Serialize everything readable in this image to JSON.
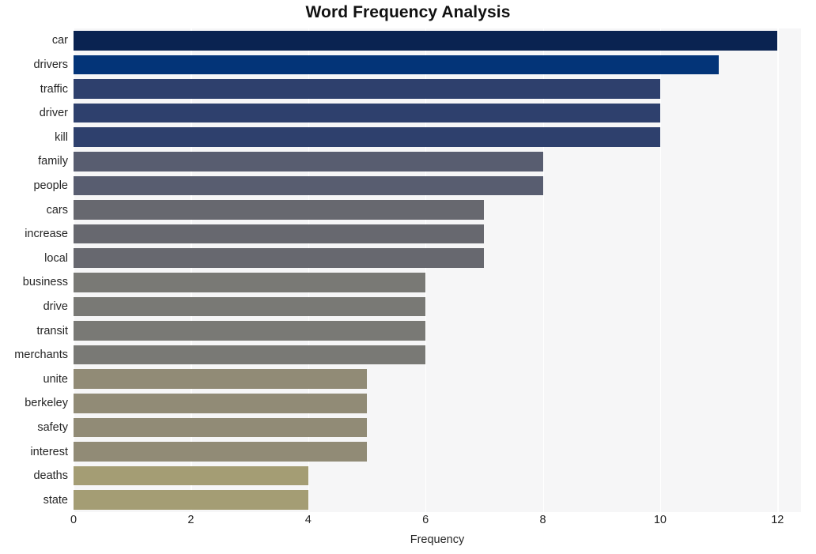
{
  "chart_data": {
    "type": "bar",
    "orientation": "horizontal",
    "title": "Word Frequency Analysis",
    "xlabel": "Frequency",
    "ylabel": "",
    "xlim": [
      0,
      12.4
    ],
    "xticks": [
      0,
      2,
      4,
      6,
      8,
      10,
      12
    ],
    "grid": true,
    "legend": "none",
    "categories": [
      "car",
      "drivers",
      "traffic",
      "driver",
      "kill",
      "family",
      "people",
      "cars",
      "increase",
      "local",
      "business",
      "drive",
      "transit",
      "merchants",
      "unite",
      "berkeley",
      "safety",
      "interest",
      "deaths",
      "state"
    ],
    "values": [
      12,
      11,
      10,
      10,
      10,
      8,
      8,
      7,
      7,
      7,
      6,
      6,
      6,
      6,
      5,
      5,
      5,
      5,
      4,
      4
    ],
    "colors": [
      "#0a2351",
      "#033478",
      "#2e406d",
      "#2e406d",
      "#2e406d",
      "#585d70",
      "#585d70",
      "#67686f",
      "#67686f",
      "#67686f",
      "#797975",
      "#797975",
      "#797975",
      "#797975",
      "#918b76",
      "#918b76",
      "#918b76",
      "#918b76",
      "#a49d74",
      "#a49d74"
    ],
    "bars": [
      {
        "label": "car",
        "value": 12,
        "color": "#0a2351"
      },
      {
        "label": "drivers",
        "value": 11,
        "color": "#033478"
      },
      {
        "label": "traffic",
        "value": 10,
        "color": "#2e406d"
      },
      {
        "label": "driver",
        "value": 10,
        "color": "#2e406d"
      },
      {
        "label": "kill",
        "value": 10,
        "color": "#2e406d"
      },
      {
        "label": "family",
        "value": 8,
        "color": "#585d70"
      },
      {
        "label": "people",
        "value": 8,
        "color": "#585d70"
      },
      {
        "label": "cars",
        "value": 7,
        "color": "#67686f"
      },
      {
        "label": "increase",
        "value": 7,
        "color": "#67686f"
      },
      {
        "label": "local",
        "value": 7,
        "color": "#67686f"
      },
      {
        "label": "business",
        "value": 6,
        "color": "#797975"
      },
      {
        "label": "drive",
        "value": 6,
        "color": "#797975"
      },
      {
        "label": "transit",
        "value": 6,
        "color": "#797975"
      },
      {
        "label": "merchants",
        "value": 6,
        "color": "#797975"
      },
      {
        "label": "unite",
        "value": 5,
        "color": "#918b76"
      },
      {
        "label": "berkeley",
        "value": 5,
        "color": "#918b76"
      },
      {
        "label": "safety",
        "value": 5,
        "color": "#918b76"
      },
      {
        "label": "interest",
        "value": 5,
        "color": "#918b76"
      },
      {
        "label": "deaths",
        "value": 4,
        "color": "#a49d74"
      },
      {
        "label": "state",
        "value": 4,
        "color": "#a49d74"
      }
    ]
  },
  "style": {
    "plot_background": "#f6f6f7",
    "gridline_color": "#ffffff",
    "text_color": "#262626",
    "title_color": "#111111"
  }
}
